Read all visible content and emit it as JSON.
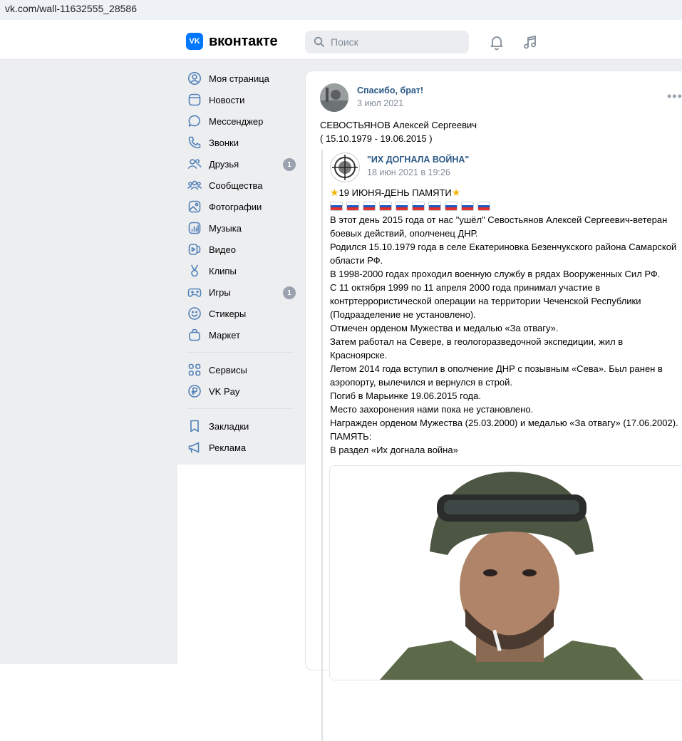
{
  "browser": {
    "url": "vk.com/wall-11632555_28586"
  },
  "header": {
    "logo_text": "вконтакте",
    "logo_mark": "VK",
    "search_placeholder": "Поиск"
  },
  "sidebar": {
    "items": [
      {
        "label": "Моя страница",
        "icon": "user-icon"
      },
      {
        "label": "Новости",
        "icon": "news-icon"
      },
      {
        "label": "Мессенджер",
        "icon": "message-icon"
      },
      {
        "label": "Звонки",
        "icon": "phone-icon"
      },
      {
        "label": "Друзья",
        "icon": "friends-icon",
        "badge": "1"
      },
      {
        "label": "Сообщества",
        "icon": "communities-icon"
      },
      {
        "label": "Фотографии",
        "icon": "photo-icon"
      },
      {
        "label": "Музыка",
        "icon": "music-icon"
      },
      {
        "label": "Видео",
        "icon": "video-icon"
      },
      {
        "label": "Клипы",
        "icon": "clips-icon"
      },
      {
        "label": "Игры",
        "icon": "games-icon",
        "badge": "1"
      },
      {
        "label": "Стикеры",
        "icon": "smile-icon"
      },
      {
        "label": "Маркет",
        "icon": "bag-icon"
      }
    ],
    "items2": [
      {
        "label": "Сервисы",
        "icon": "grid-icon"
      },
      {
        "label": "VK Pay",
        "icon": "ruble-icon"
      }
    ],
    "items3": [
      {
        "label": "Закладки",
        "icon": "bookmark-icon"
      },
      {
        "label": "Реклама",
        "icon": "megaphone-icon"
      }
    ]
  },
  "post": {
    "author": "Спасибо, брат!",
    "date": "3 июл 2021",
    "text_line1": "СЕВОСТЬЯНОВ Алексей Сергеевич",
    "text_line2": "( 15.10.1979 - 19.06.2015 )"
  },
  "repost": {
    "author": "\"ИХ ДОГНАЛА ВОЙНА\"",
    "date": "18 июн 2021 в 19:26",
    "heading": "19 ИЮНЯ-ДЕНЬ ПАМЯТИ",
    "flag_count": 10,
    "lines": [
      "В этот день 2015 года от нас \"ушёл\" Севостьянов Алексей Сергеевич-ветеран",
      "боевых действий, ополченец ДНР.",
      "Родился 15.10.1979 года в селе Екатериновка Безенчукского района Самарской",
      "области РФ.",
      "В 1998-2000 годах проходил военную службу в рядах Вооруженных Сил РФ.",
      "С 11 октября 1999 по 11 апреля 2000 года принимал участие в",
      "контртеррористической операции на территории Чеченской Республики",
      "(Подразделение не установлено).",
      "Отмечен орденом Мужества и медалью «За отвагу».",
      "Затем работал на Севере, в геологоразведочной экспедиции, жил в",
      "Красноярске.",
      "Летом 2014 года вступил в ополчение ДНР с позывным «Сева». Был ранен в",
      "аэропорту, вылечился и вернулся в строй.",
      "Погиб в Марьинке 19.06.2015 года.",
      "Место захоронения нами пока не установлено.",
      "Награжден орденом Мужества (25.03.2000) и медалью «За отвагу» (17.06.2002).",
      "ПАМЯТЬ:",
      "В раздел «Их догнала война»"
    ]
  },
  "colors": {
    "accent": "#0077ff",
    "link": "#2a5885",
    "muted": "#818c99",
    "bg": "#edeef0"
  }
}
